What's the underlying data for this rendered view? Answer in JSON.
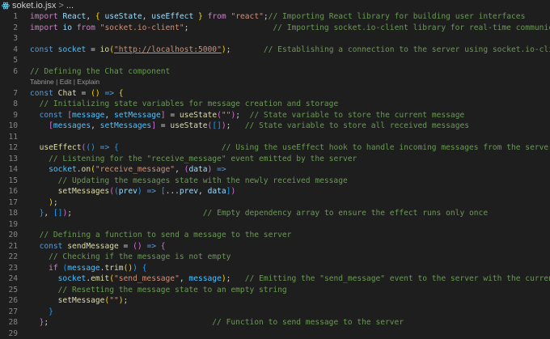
{
  "breadcrumb": {
    "file": "soket.io.jsx",
    "separator": ">",
    "more": "..."
  },
  "codelens": "Tabnine | Edit | Explain",
  "lines": [
    {
      "n": "1",
      "tokens": [
        [
          "kw",
          "import"
        ],
        [
          "txt",
          " "
        ],
        [
          "var",
          "React"
        ],
        [
          "txt",
          ", "
        ],
        [
          "p1",
          "{"
        ],
        [
          "txt",
          " "
        ],
        [
          "var",
          "useState"
        ],
        [
          "txt",
          ", "
        ],
        [
          "var",
          "useEffect"
        ],
        [
          "txt",
          " "
        ],
        [
          "p1",
          "}"
        ],
        [
          "txt",
          " "
        ],
        [
          "kw",
          "from"
        ],
        [
          "txt",
          " "
        ],
        [
          "str",
          "\"react\""
        ],
        [
          "txt",
          ";"
        ],
        [
          "com",
          "// Importing React library for building user interfaces"
        ]
      ]
    },
    {
      "n": "2",
      "tokens": [
        [
          "kw",
          "import"
        ],
        [
          "txt",
          " "
        ],
        [
          "var",
          "io"
        ],
        [
          "txt",
          " "
        ],
        [
          "kw",
          "from"
        ],
        [
          "txt",
          " "
        ],
        [
          "str",
          "\"socket.io-client\""
        ],
        [
          "txt",
          ";                  "
        ],
        [
          "com",
          "// Importing socket.io-client library for real-time communication"
        ]
      ]
    },
    {
      "n": "3",
      "tokens": []
    },
    {
      "n": "4",
      "tokens": [
        [
          "sk",
          "const"
        ],
        [
          "txt",
          " "
        ],
        [
          "cst",
          "socket"
        ],
        [
          "txt",
          " = "
        ],
        [
          "fn",
          "io"
        ],
        [
          "p1",
          "("
        ],
        [
          "link",
          "\"http://localhost:5000\""
        ],
        [
          "p1",
          ")"
        ],
        [
          "txt",
          ";       "
        ],
        [
          "com",
          "// Establishing a connection to the server using socket.io-client"
        ]
      ]
    },
    {
      "n": "5",
      "tokens": []
    },
    {
      "n": "6",
      "tokens": [
        [
          "com",
          "// Defining the Chat component"
        ]
      ]
    },
    {
      "n": "",
      "lens": true
    },
    {
      "n": "7",
      "tokens": [
        [
          "sk",
          "const"
        ],
        [
          "txt",
          " "
        ],
        [
          "fn",
          "Chat"
        ],
        [
          "txt",
          " = "
        ],
        [
          "p1",
          "()"
        ],
        [
          "txt",
          " "
        ],
        [
          "sk",
          "=>"
        ],
        [
          "txt",
          " "
        ],
        [
          "p1",
          "{"
        ]
      ]
    },
    {
      "n": "8",
      "tokens": [
        [
          "txt",
          "  "
        ],
        [
          "com",
          "// Initializing state variables for message creation and storage"
        ]
      ]
    },
    {
      "n": "9",
      "tokens": [
        [
          "txt",
          "  "
        ],
        [
          "sk",
          "const"
        ],
        [
          "txt",
          " "
        ],
        [
          "p2",
          "["
        ],
        [
          "cst",
          "message"
        ],
        [
          "txt",
          ", "
        ],
        [
          "cst",
          "setMessage"
        ],
        [
          "p2",
          "]"
        ],
        [
          "txt",
          " = "
        ],
        [
          "fn",
          "useState"
        ],
        [
          "p2",
          "("
        ],
        [
          "str",
          "\"\""
        ],
        [
          "p2",
          ")"
        ],
        [
          "txt",
          ";  "
        ],
        [
          "com",
          "// State variable to store the current message"
        ]
      ]
    },
    {
      "n": "10",
      "tokens": [
        [
          "txt",
          "    "
        ],
        [
          "p2",
          "["
        ],
        [
          "cst",
          "messages"
        ],
        [
          "txt",
          ", "
        ],
        [
          "cst",
          "setMessages"
        ],
        [
          "p2",
          "]"
        ],
        [
          "txt",
          " = "
        ],
        [
          "fn",
          "useState"
        ],
        [
          "p2",
          "("
        ],
        [
          "p3",
          "[]"
        ],
        [
          "p2",
          ")"
        ],
        [
          "txt",
          ";   "
        ],
        [
          "com",
          "// State variable to store all received messages"
        ]
      ]
    },
    {
      "n": "11",
      "tokens": []
    },
    {
      "n": "12",
      "tokens": [
        [
          "txt",
          "  "
        ],
        [
          "fn",
          "useEffect"
        ],
        [
          "p2",
          "("
        ],
        [
          "p3",
          "()"
        ],
        [
          "txt",
          " "
        ],
        [
          "sk",
          "=>"
        ],
        [
          "txt",
          " "
        ],
        [
          "p3",
          "{"
        ],
        [
          "txt",
          "                      "
        ],
        [
          "com",
          "// Using the useEffect hook to handle incoming messages from the server"
        ]
      ]
    },
    {
      "n": "13",
      "tokens": [
        [
          "txt",
          "    "
        ],
        [
          "com",
          "// Listening for the \"receive_message\" event emitted by the server"
        ]
      ]
    },
    {
      "n": "14",
      "tokens": [
        [
          "txt",
          "    "
        ],
        [
          "cst",
          "socket"
        ],
        [
          "txt",
          "."
        ],
        [
          "fn",
          "on"
        ],
        [
          "p1",
          "("
        ],
        [
          "str",
          "\"receive_message\""
        ],
        [
          "txt",
          ", "
        ],
        [
          "p2",
          "("
        ],
        [
          "var",
          "data"
        ],
        [
          "p2",
          ")"
        ],
        [
          "txt",
          " "
        ],
        [
          "sk",
          "=>"
        ]
      ]
    },
    {
      "n": "15",
      "tokens": [
        [
          "txt",
          "      "
        ],
        [
          "com",
          "// Updating the messages state with the newly received message"
        ]
      ]
    },
    {
      "n": "16",
      "tokens": [
        [
          "txt",
          "      "
        ],
        [
          "fn",
          "setMessages"
        ],
        [
          "p2",
          "("
        ],
        [
          "p3",
          "("
        ],
        [
          "var",
          "prev"
        ],
        [
          "p3",
          ")"
        ],
        [
          "txt",
          " "
        ],
        [
          "sk",
          "=>"
        ],
        [
          "txt",
          " "
        ],
        [
          "p3",
          "["
        ],
        [
          "txt",
          "..."
        ],
        [
          "var",
          "prev"
        ],
        [
          "txt",
          ", "
        ],
        [
          "var",
          "data"
        ],
        [
          "p3",
          "]"
        ],
        [
          "p2",
          ")"
        ]
      ]
    },
    {
      "n": "17",
      "tokens": [
        [
          "txt",
          "    "
        ],
        [
          "p1",
          ")"
        ],
        [
          "txt",
          ";"
        ]
      ]
    },
    {
      "n": "18",
      "tokens": [
        [
          "txt",
          "  "
        ],
        [
          "p3",
          "}"
        ],
        [
          "txt",
          ", "
        ],
        [
          "p3",
          "[]"
        ],
        [
          "p2",
          ")"
        ],
        [
          "txt",
          ";                            "
        ],
        [
          "com",
          "// Empty dependency array to ensure the effect runs only once"
        ]
      ]
    },
    {
      "n": "19",
      "tokens": []
    },
    {
      "n": "20",
      "tokens": [
        [
          "txt",
          "  "
        ],
        [
          "com",
          "// Defining a function to send a message to the server"
        ]
      ]
    },
    {
      "n": "21",
      "tokens": [
        [
          "txt",
          "  "
        ],
        [
          "sk",
          "const"
        ],
        [
          "txt",
          " "
        ],
        [
          "fn",
          "sendMessage"
        ],
        [
          "txt",
          " = "
        ],
        [
          "p2",
          "()"
        ],
        [
          "txt",
          " "
        ],
        [
          "sk",
          "=>"
        ],
        [
          "txt",
          " "
        ],
        [
          "p2",
          "{"
        ]
      ]
    },
    {
      "n": "22",
      "tokens": [
        [
          "txt",
          "    "
        ],
        [
          "com",
          "// Checking if the message is not empty"
        ]
      ]
    },
    {
      "n": "23",
      "tokens": [
        [
          "txt",
          "    "
        ],
        [
          "kw",
          "if"
        ],
        [
          "txt",
          " "
        ],
        [
          "p3",
          "("
        ],
        [
          "cst",
          "message"
        ],
        [
          "txt",
          "."
        ],
        [
          "fn",
          "trim"
        ],
        [
          "p1",
          "()"
        ],
        [
          "p3",
          ")"
        ],
        [
          "txt",
          " "
        ],
        [
          "p3",
          "{"
        ]
      ]
    },
    {
      "n": "24",
      "tokens": [
        [
          "txt",
          "      "
        ],
        [
          "cst",
          "socket"
        ],
        [
          "txt",
          "."
        ],
        [
          "fn",
          "emit"
        ],
        [
          "p1",
          "("
        ],
        [
          "str",
          "\"send_message\""
        ],
        [
          "txt",
          ", "
        ],
        [
          "cst",
          "message"
        ],
        [
          "p1",
          ")"
        ],
        [
          "txt",
          ";   "
        ],
        [
          "com",
          "// Emitting the \"send_message\" event to the server with the current message"
        ]
      ]
    },
    {
      "n": "25",
      "tokens": [
        [
          "txt",
          "      "
        ],
        [
          "com",
          "// Resetting the message state to an empty string"
        ]
      ]
    },
    {
      "n": "26",
      "tokens": [
        [
          "txt",
          "      "
        ],
        [
          "fn",
          "setMessage"
        ],
        [
          "p1",
          "("
        ],
        [
          "str",
          "\"\""
        ],
        [
          "p1",
          ")"
        ],
        [
          "txt",
          ";"
        ]
      ]
    },
    {
      "n": "27",
      "tokens": [
        [
          "txt",
          "    "
        ],
        [
          "p3",
          "}"
        ]
      ]
    },
    {
      "n": "28",
      "tokens": [
        [
          "txt",
          "  "
        ],
        [
          "p2",
          "}"
        ],
        [
          "txt",
          ";                                   "
        ],
        [
          "com",
          "// Function to send message to the server"
        ]
      ]
    },
    {
      "n": "29",
      "tokens": []
    }
  ]
}
